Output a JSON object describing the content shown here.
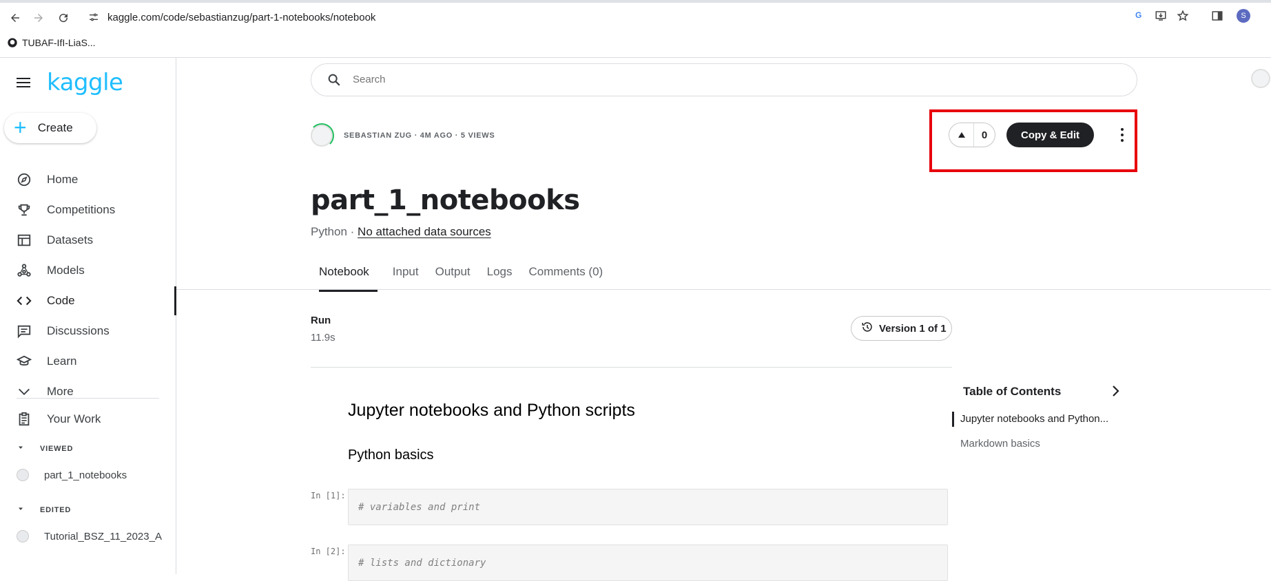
{
  "browser": {
    "url": "kaggle.com/code/sebastianzug/part-1-notebooks/notebook",
    "bookmark": "TUBAF-IfI-LiaS...",
    "profile_initial": "S"
  },
  "sidebar": {
    "logo": "kaggle",
    "create_label": "Create",
    "items": [
      {
        "label": "Home",
        "icon": "compass-icon"
      },
      {
        "label": "Competitions",
        "icon": "trophy-icon"
      },
      {
        "label": "Datasets",
        "icon": "table-icon"
      },
      {
        "label": "Models",
        "icon": "models-icon"
      },
      {
        "label": "Code",
        "icon": "code-icon",
        "active": true
      },
      {
        "label": "Discussions",
        "icon": "comment-icon"
      },
      {
        "label": "Learn",
        "icon": "school-icon"
      },
      {
        "label": "More",
        "icon": "chevron-down-icon"
      }
    ],
    "your_work": "Your Work",
    "viewed_label": "VIEWED",
    "viewed_item": "part_1_notebooks",
    "edited_label": "EDITED",
    "edited_item": "Tutorial_BSZ_11_2023_A"
  },
  "search": {
    "placeholder": "Search"
  },
  "notebook": {
    "author_meta": "SEBASTIAN ZUG · 4M AGO · 5 VIEWS",
    "vote_count": "0",
    "copy_edit_label": "Copy & Edit",
    "title": "part_1_notebooks",
    "language": "Python",
    "separator": " · ",
    "data_sources": "No attached data sources",
    "tabs": [
      "Notebook",
      "Input",
      "Output",
      "Logs",
      "Comments (0)"
    ],
    "run_label": "Run",
    "run_time": "11.9s",
    "version_label": "Version 1 of 1",
    "heading1": "Jupyter notebooks and Python scripts",
    "heading2": "Python basics",
    "cells": [
      {
        "prompt": "In [1]:",
        "code": "# variables and print"
      },
      {
        "prompt": "In [2]:",
        "code": "# lists and dictionary"
      }
    ]
  },
  "toc": {
    "title": "Table of Contents",
    "items": [
      "Jupyter notebooks and Python...",
      "Markdown basics"
    ]
  },
  "colors": {
    "accent": "#20beff",
    "highlight": "#e8000b",
    "primary_button": "#202124"
  }
}
